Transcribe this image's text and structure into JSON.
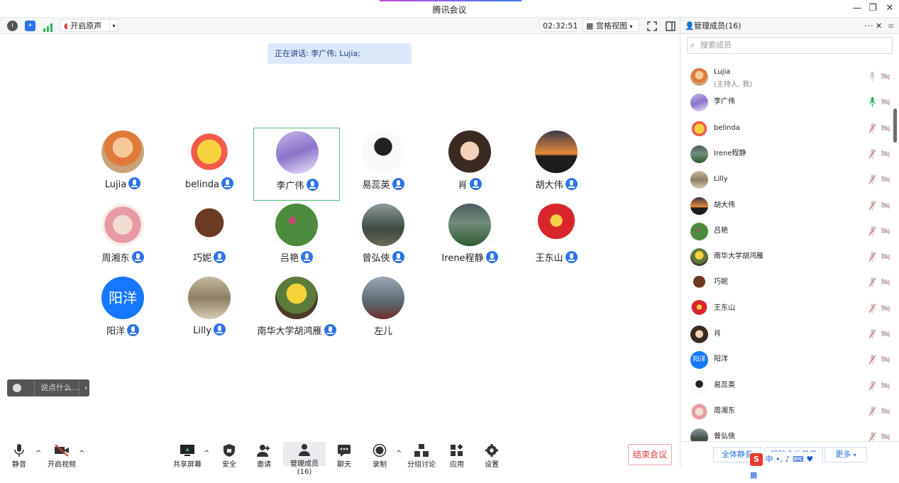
{
  "window": {
    "title": "腾讯会议"
  },
  "top_toolbar": {
    "original_sound_label": "开启原声",
    "timer": "02:32:51",
    "view_label": "宫格视图"
  },
  "speaking_banner": "正在讲话: 李广伟; Lujia;",
  "participants": [
    {
      "name": "Lujia",
      "mic": true,
      "active": false
    },
    {
      "name": "belinda",
      "mic": true,
      "active": false
    },
    {
      "name": "李广伟",
      "mic": true,
      "active": true
    },
    {
      "name": "易蕊英",
      "mic": true,
      "active": false
    },
    {
      "name": "肖",
      "mic": true,
      "active": false
    },
    {
      "name": "胡大伟",
      "mic": true,
      "active": false
    },
    {
      "name": "周湘东",
      "mic": true,
      "active": false
    },
    {
      "name": "巧妮",
      "mic": true,
      "active": false
    },
    {
      "name": "吕艳",
      "mic": true,
      "active": false
    },
    {
      "name": "曾弘俠",
      "mic": true,
      "active": false
    },
    {
      "name": "Irene程静",
      "mic": true,
      "active": false
    },
    {
      "name": "王东山",
      "mic": true,
      "active": false
    },
    {
      "name": "阳洋",
      "mic": true,
      "active": false,
      "avatar_text": "阳洋"
    },
    {
      "name": "Lilly",
      "mic": true,
      "active": false
    },
    {
      "name": "南华大学胡鸿雁",
      "mic": true,
      "active": false
    },
    {
      "name": "左儿",
      "mic": false,
      "active": false
    }
  ],
  "chat_pill": {
    "placeholder": "说点什么..."
  },
  "bottom_toolbar": {
    "mute": "静音",
    "video": "开启视频",
    "share": "共享屏幕",
    "security": "安全",
    "invite": "邀请",
    "members": "管理成员(16)",
    "chat": "聊天",
    "record": "录制",
    "breakout": "分组讨论",
    "apps": "应用",
    "settings": "设置",
    "end": "结束会议"
  },
  "panel": {
    "title": "管理成员(16)",
    "search_placeholder": "搜索成员",
    "members": [
      {
        "name": "Lujia",
        "sub": "(主持人, 我)",
        "mic": "idle"
      },
      {
        "name": "李广伟",
        "sub": "",
        "mic": "speaking"
      },
      {
        "name": "belinda",
        "sub": "",
        "mic": "muted"
      },
      {
        "name": "Irene程静",
        "sub": "",
        "mic": "muted"
      },
      {
        "name": "Lilly",
        "sub": "",
        "mic": "muted"
      },
      {
        "name": "胡大伟",
        "sub": "",
        "mic": "muted"
      },
      {
        "name": "吕艳",
        "sub": "",
        "mic": "muted"
      },
      {
        "name": "南华大学胡鸿雁",
        "sub": "",
        "mic": "muted"
      },
      {
        "name": "巧妮",
        "sub": "",
        "mic": "muted"
      },
      {
        "name": "王东山",
        "sub": "",
        "mic": "muted"
      },
      {
        "name": "肖",
        "sub": "",
        "mic": "muted"
      },
      {
        "name": "阳洋",
        "sub": "",
        "mic": "muted",
        "avatar_text": "阳洋"
      },
      {
        "name": "易蕊英",
        "sub": "",
        "mic": "muted"
      },
      {
        "name": "周湘东",
        "sub": "",
        "mic": "muted"
      },
      {
        "name": "曾弘俠",
        "sub": "",
        "mic": "muted"
      }
    ],
    "mute_all": "全体静音",
    "unmute_all": "解除全体静音",
    "more": "更多"
  },
  "ime_bar": {
    "label": "中"
  }
}
